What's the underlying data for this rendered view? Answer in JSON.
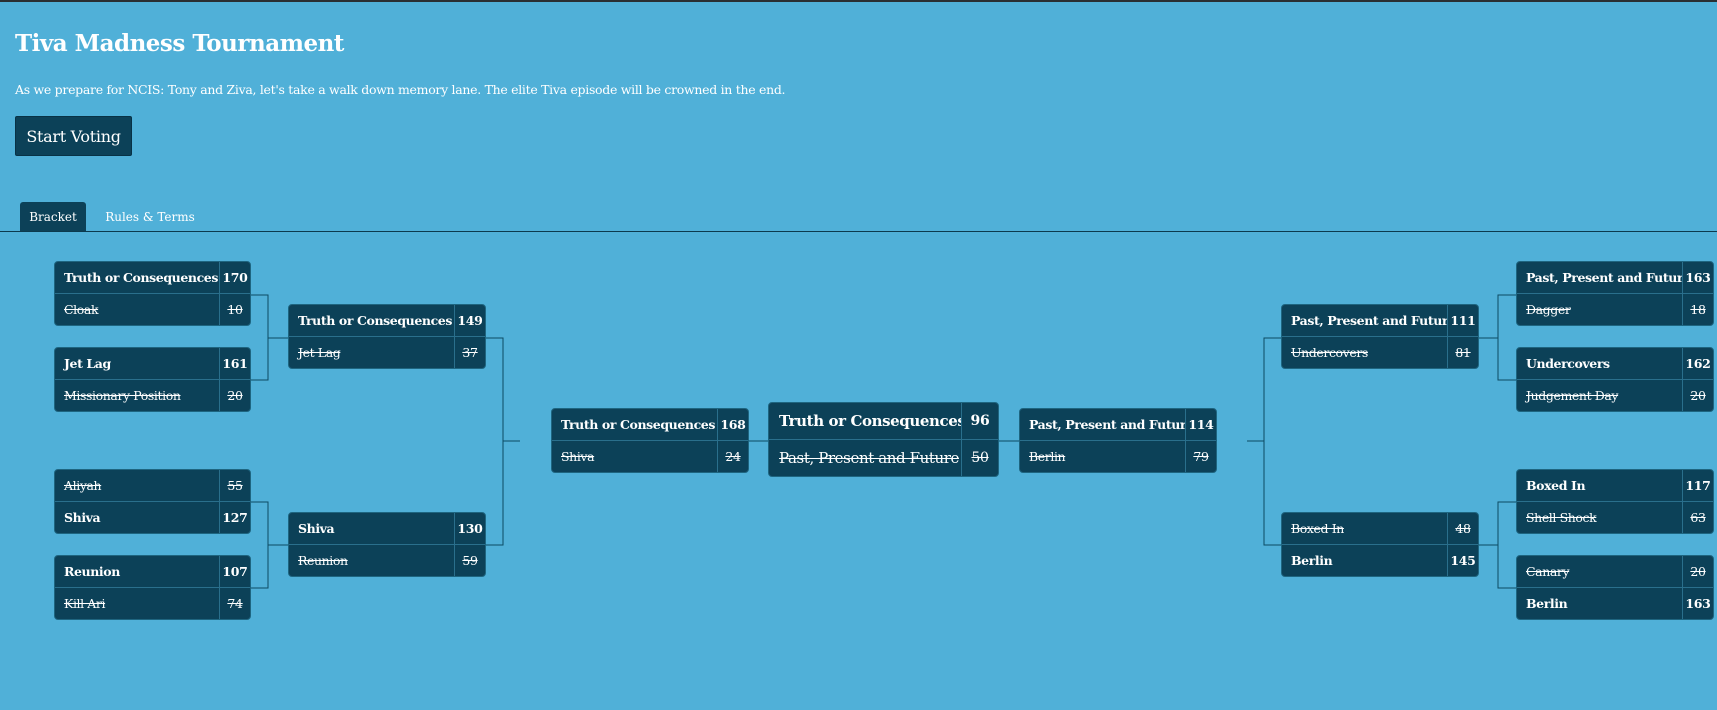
{
  "header": {
    "title": "Tiva Madness Tournament",
    "subtitle": "As we prepare for NCIS: Tony and Ziva, let's take a walk down memory lane. The elite Tiva episode will be crowned in the end.",
    "start_button": "Start Voting"
  },
  "tabs": [
    {
      "label": "Bracket",
      "active": true
    },
    {
      "label": "Rules & Terms",
      "active": false
    }
  ],
  "colors": {
    "background": "#50b0d8",
    "card": "#0c4158",
    "divider": "#2a6f8c"
  },
  "bracket": {
    "left_r1": [
      {
        "teams": [
          {
            "name": "Truth or Consequences",
            "score": "170",
            "winner": true
          },
          {
            "name": "Cloak",
            "score": "10",
            "winner": false
          }
        ]
      },
      {
        "teams": [
          {
            "name": "Jet Lag",
            "score": "161",
            "winner": true
          },
          {
            "name": "Missionary Position",
            "score": "20",
            "winner": false
          }
        ]
      },
      {
        "teams": [
          {
            "name": "Aliyah",
            "score": "55",
            "winner": false
          },
          {
            "name": "Shiva",
            "score": "127",
            "winner": true
          }
        ]
      },
      {
        "teams": [
          {
            "name": "Reunion",
            "score": "107",
            "winner": true
          },
          {
            "name": "Kill Ari",
            "score": "74",
            "winner": false
          }
        ]
      }
    ],
    "left_r2": [
      {
        "teams": [
          {
            "name": "Truth or Consequences",
            "score": "149",
            "winner": true
          },
          {
            "name": "Jet Lag",
            "score": "37",
            "winner": false
          }
        ]
      },
      {
        "teams": [
          {
            "name": "Shiva",
            "score": "130",
            "winner": true
          },
          {
            "name": "Reunion",
            "score": "59",
            "winner": false
          }
        ]
      }
    ],
    "left_r3": [
      {
        "teams": [
          {
            "name": "Truth or Consequences",
            "score": "168",
            "winner": true
          },
          {
            "name": "Shiva",
            "score": "24",
            "winner": false
          }
        ]
      }
    ],
    "final": [
      {
        "teams": [
          {
            "name": "Truth or Consequences",
            "score": "96",
            "winner": true
          },
          {
            "name": "Past, Present and Future",
            "score": "50",
            "winner": false
          }
        ]
      }
    ],
    "right_r3": [
      {
        "teams": [
          {
            "name": "Past, Present and Future",
            "score": "114",
            "winner": true
          },
          {
            "name": "Berlin",
            "score": "79",
            "winner": false
          }
        ]
      }
    ],
    "right_r2": [
      {
        "teams": [
          {
            "name": "Past, Present and Future",
            "score": "111",
            "winner": true
          },
          {
            "name": "Undercovers",
            "score": "81",
            "winner": false
          }
        ]
      },
      {
        "teams": [
          {
            "name": "Boxed In",
            "score": "48",
            "winner": false
          },
          {
            "name": "Berlin",
            "score": "145",
            "winner": true
          }
        ]
      }
    ],
    "right_r1": [
      {
        "teams": [
          {
            "name": "Past, Present and Future",
            "score": "163",
            "winner": true
          },
          {
            "name": "Dagger",
            "score": "18",
            "winner": false
          }
        ]
      },
      {
        "teams": [
          {
            "name": "Undercovers",
            "score": "162",
            "winner": true
          },
          {
            "name": "Judgement Day",
            "score": "20",
            "winner": false
          }
        ]
      },
      {
        "teams": [
          {
            "name": "Boxed In",
            "score": "117",
            "winner": true
          },
          {
            "name": "Shell Shock",
            "score": "63",
            "winner": false
          }
        ]
      },
      {
        "teams": [
          {
            "name": "Canary",
            "score": "20",
            "winner": false
          },
          {
            "name": "Berlin",
            "score": "163",
            "winner": true
          }
        ]
      }
    ]
  }
}
